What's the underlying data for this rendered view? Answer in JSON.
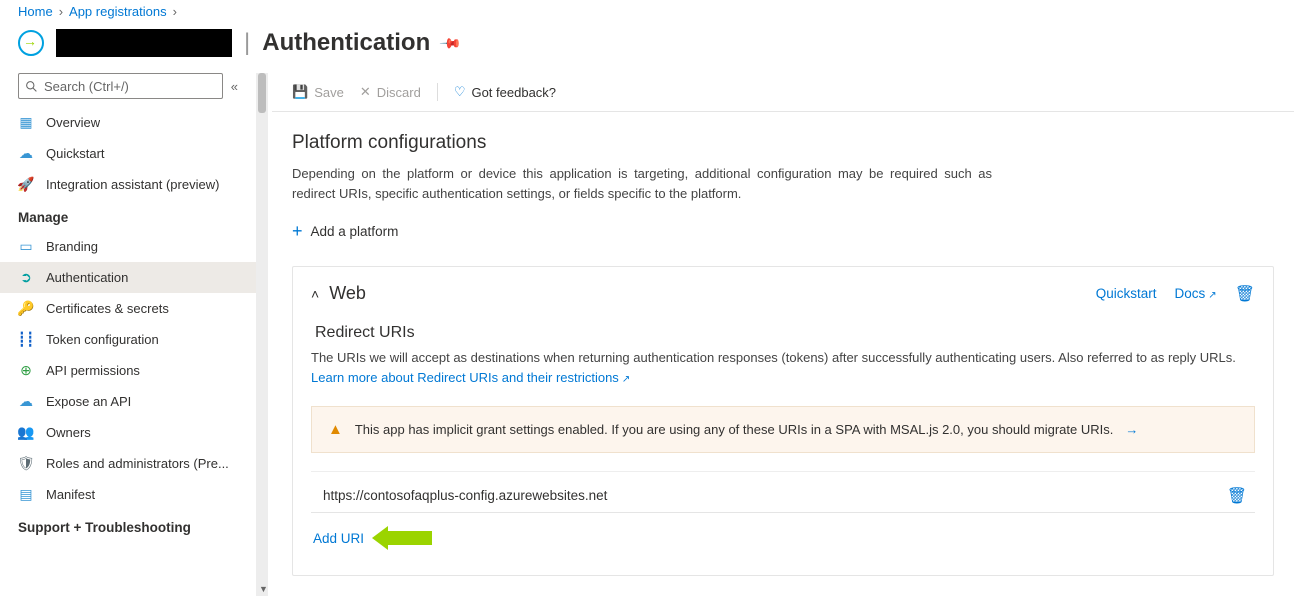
{
  "breadcrumb": {
    "home": "Home",
    "appreg": "App registrations"
  },
  "header": {
    "page_title": "Authentication"
  },
  "search": {
    "placeholder": "Search (Ctrl+/)"
  },
  "nav": {
    "items": [
      {
        "label": "Overview"
      },
      {
        "label": "Quickstart"
      },
      {
        "label": "Integration assistant (preview)"
      }
    ],
    "manage_title": "Manage",
    "manage": [
      {
        "label": "Branding"
      },
      {
        "label": "Authentication"
      },
      {
        "label": "Certificates & secrets"
      },
      {
        "label": "Token configuration"
      },
      {
        "label": "API permissions"
      },
      {
        "label": "Expose an API"
      },
      {
        "label": "Owners"
      },
      {
        "label": "Roles and administrators (Pre..."
      },
      {
        "label": "Manifest"
      }
    ],
    "support_title": "Support + Troubleshooting"
  },
  "toolbar": {
    "save": "Save",
    "discard": "Discard",
    "feedback": "Got feedback?"
  },
  "platform": {
    "title": "Platform configurations",
    "desc": "Depending on the platform or device this application is targeting, additional configuration may be required such as redirect URIs, specific authentication settings, or fields specific to the platform.",
    "add": "Add a platform"
  },
  "web": {
    "title": "Web",
    "quickstart": "Quickstart",
    "docs": "Docs",
    "redirect_title": "Redirect URIs",
    "redirect_desc": "The URIs we will accept as destinations when returning authentication responses (tokens) after successfully authenticating users. Also referred to as reply URLs. ",
    "learn_link": "Learn more about Redirect URIs and their restrictions",
    "warning": "This app has implicit grant settings enabled. If you are using any of these URIs in a SPA with MSAL.js 2.0, you should migrate URIs.",
    "uri_value": "https://contosofaqplus-config.azurewebsites.net",
    "add_uri": "Add URI"
  }
}
